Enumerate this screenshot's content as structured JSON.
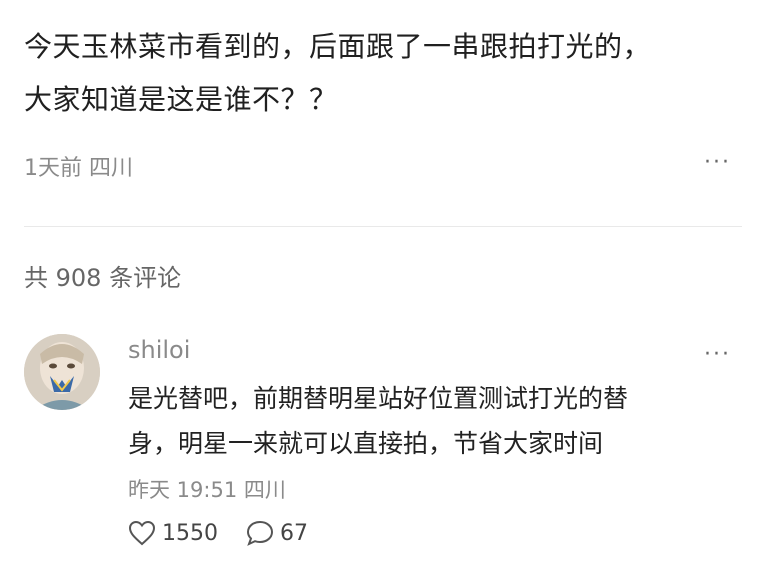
{
  "post": {
    "line1": "今天玉林菜市看到的，后面跟了一串跟拍打光的，",
    "line2": "大家知道是这是谁不？？",
    "time": "1天前",
    "location": "四川",
    "more_label": "···"
  },
  "comments_header": {
    "label": "共 908 条评论"
  },
  "comment": {
    "username": "shiloi",
    "line1": "是光替吧，前期替明星站好位置测试打光的替",
    "line2": "身，明星一来就可以直接拍，节省大家时间",
    "time": "昨天 19:51",
    "location": "四川",
    "more_label": "···",
    "likes": "1550",
    "replies": "67"
  },
  "colors": {
    "text": "#202020",
    "meta": "#8a8a8a",
    "divider": "#e9e9e9"
  },
  "icons": [
    "heart-icon",
    "comment-bubble-icon"
  ]
}
